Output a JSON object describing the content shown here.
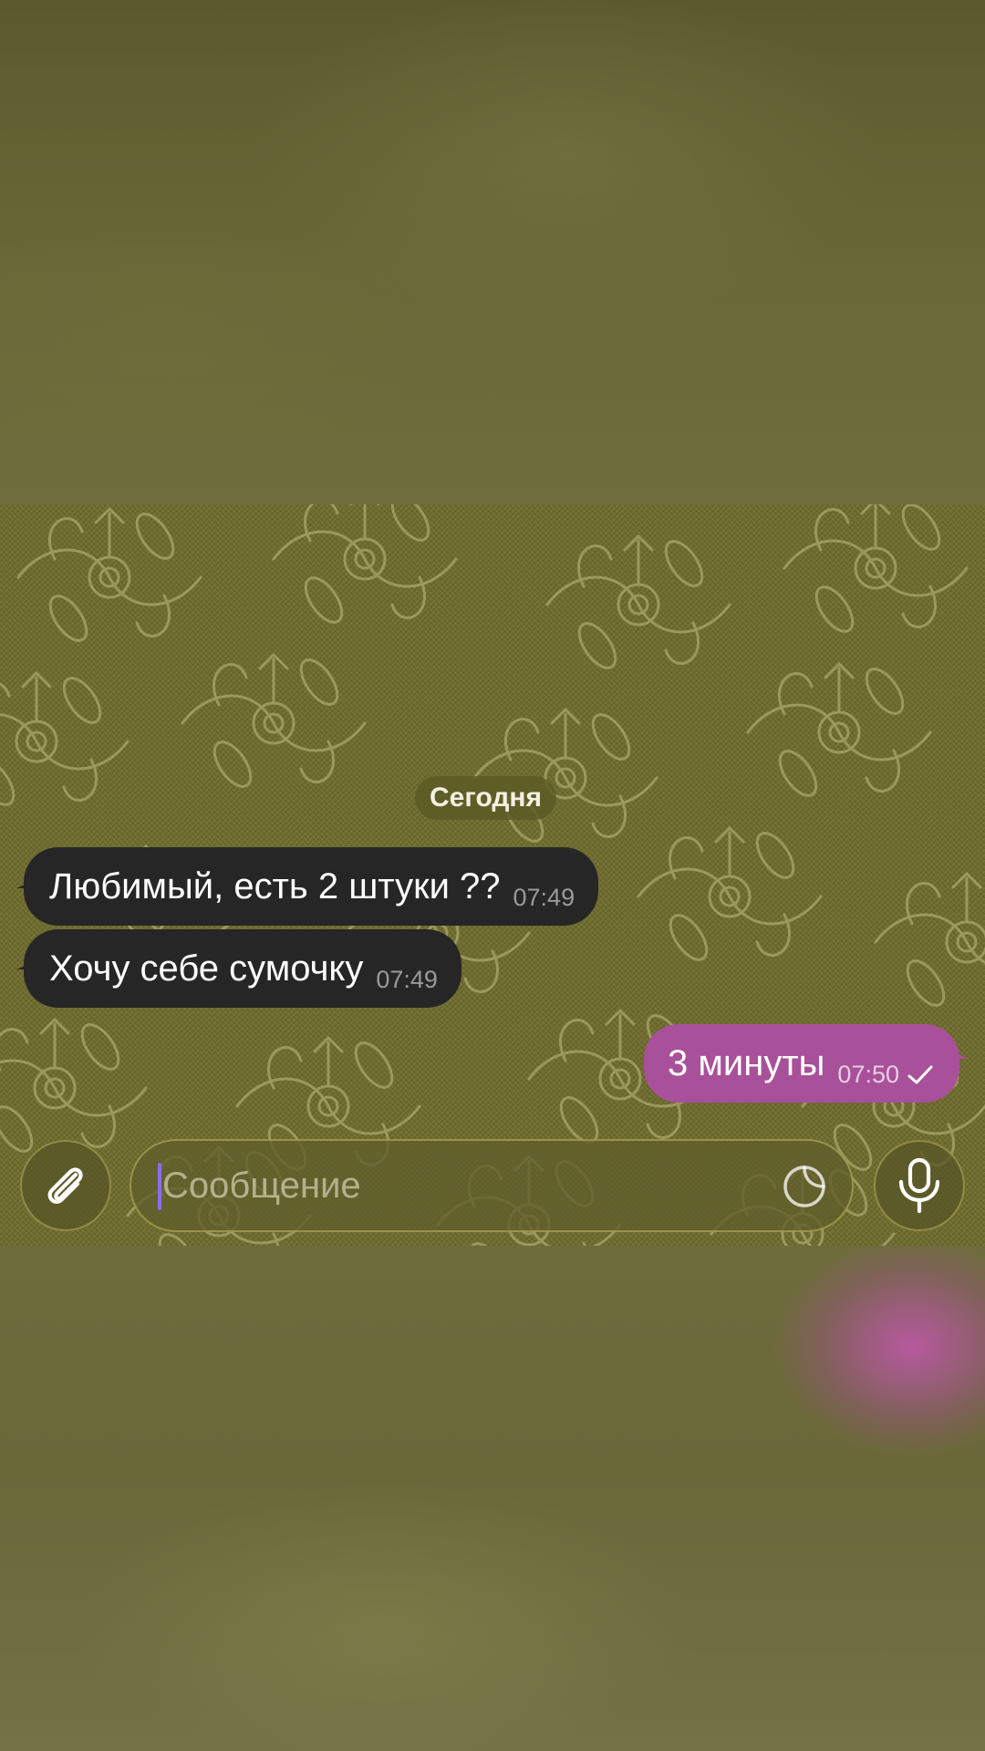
{
  "chat": {
    "date_chip": "Сегодня",
    "messages": [
      {
        "direction": "incoming",
        "text": "Любимый, есть 2 штуки ??",
        "time": "07:49"
      },
      {
        "direction": "incoming",
        "text": "Хочу себе сумочку",
        "time": "07:49"
      },
      {
        "direction": "outgoing",
        "text": "3 минуты",
        "time": "07:50",
        "status": "sent"
      }
    ]
  },
  "composer": {
    "placeholder": "Сообщение",
    "icons": {
      "attach": "paperclip-icon",
      "sticker": "sticker-icon",
      "voice": "microphone-icon"
    }
  },
  "colors": {
    "incoming_bubble": "#262626",
    "outgoing_bubble": "#a9509a",
    "wallpaper": "#6b6b2f",
    "caret": "#8c6cf0"
  }
}
